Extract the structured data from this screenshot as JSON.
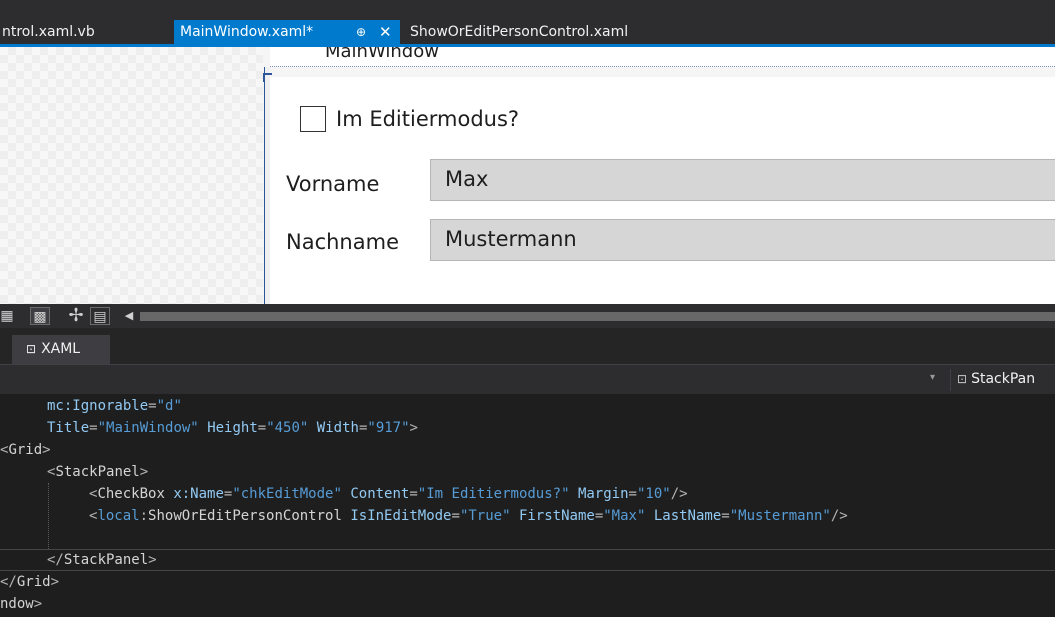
{
  "tabs": [
    {
      "label": "ntrol.xaml.vb",
      "active": false
    },
    {
      "label": "MainWindow.xaml*",
      "active": true,
      "pin": "⊕",
      "close": "✕"
    },
    {
      "label": "ShowOrEditPersonControl.xaml",
      "active": false
    }
  ],
  "designer": {
    "window_title": "MainWindow",
    "checkbox": {
      "label": "Im Editiermodus?",
      "checked": false
    },
    "fields": [
      {
        "label": "Vorname",
        "value": "Max"
      },
      {
        "label": "Nachname",
        "value": "Mustermann"
      }
    ]
  },
  "toolbar": {
    "icons": [
      "grid-icon",
      "checkerboard-icon",
      "snap-icon",
      "document-icon",
      "scroll-left-icon"
    ]
  },
  "xaml_tab": {
    "icon": "⊡",
    "label": "XAML"
  },
  "navbar": {
    "dropdown": "▾",
    "scope_icon": "⊡",
    "scope": "StackPan"
  },
  "code": {
    "l1": {
      "attr": "mc:Ignorable",
      "val": "\"d\""
    },
    "l2": {
      "a1": "Title",
      "v1": "\"MainWindow\"",
      "a2": "Height",
      "v2": "\"450\"",
      "a3": "Width",
      "v3": "\"917\""
    },
    "l3": {
      "elem": "Grid"
    },
    "l4": {
      "elem": "StackPanel"
    },
    "l5": {
      "elem": "CheckBox",
      "a1": "x:Name",
      "v1": "\"chkEditMode\"",
      "a2": "Content",
      "v2": "\"Im Editiermodus?\"",
      "a3": "Margin",
      "v3": "\"10\""
    },
    "l6": {
      "prefix": "local",
      "elem": "ShowOrEditPersonControl",
      "a1": "IsInEditMode",
      "v1": "\"True\"",
      "a2": "FirstName",
      "v2": "\"Max\"",
      "a3": "LastName",
      "v3": "\"Mustermann\""
    },
    "l7": {
      "elem": "StackPanel"
    },
    "l8": {
      "elem": "Grid"
    },
    "l9": {
      "elem": "ndow"
    }
  },
  "colors": {
    "accent": "#007acc",
    "editor_bg": "#1e1e1e",
    "xml_attr": "#92caf4",
    "xml_value": "#569cd6",
    "xml_punct": "#b4b4b4"
  }
}
